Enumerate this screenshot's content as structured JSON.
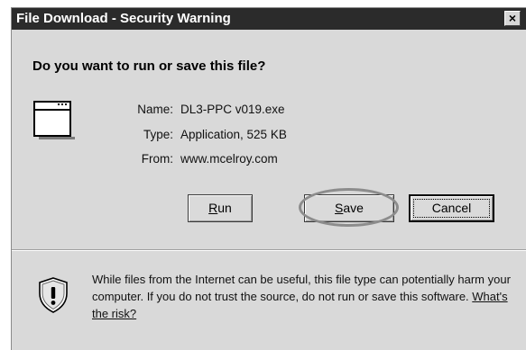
{
  "window": {
    "title": "File Download - Security Warning",
    "close_glyph": "×"
  },
  "question": "Do you want to run or save this file?",
  "file_info": {
    "name_label": "Name:",
    "name_value": "DL3-PPC v019.exe",
    "type_label": "Type:",
    "type_value": "Application, 525 KB",
    "from_label": "From:",
    "from_value": "www.mcelroy.com"
  },
  "buttons": {
    "run_mnemonic": "R",
    "run_rest": "un",
    "save_mnemonic": "S",
    "save_rest": "ave",
    "cancel": "Cancel"
  },
  "warning": {
    "text": "While files from the Internet can be useful, this file type can potentially harm your computer. If you do not trust the source, do not run or save this software. ",
    "risk_link": "What's the risk?"
  },
  "icons": {
    "app": "application-window-icon",
    "shield": "security-shield-icon",
    "close": "close-icon"
  }
}
